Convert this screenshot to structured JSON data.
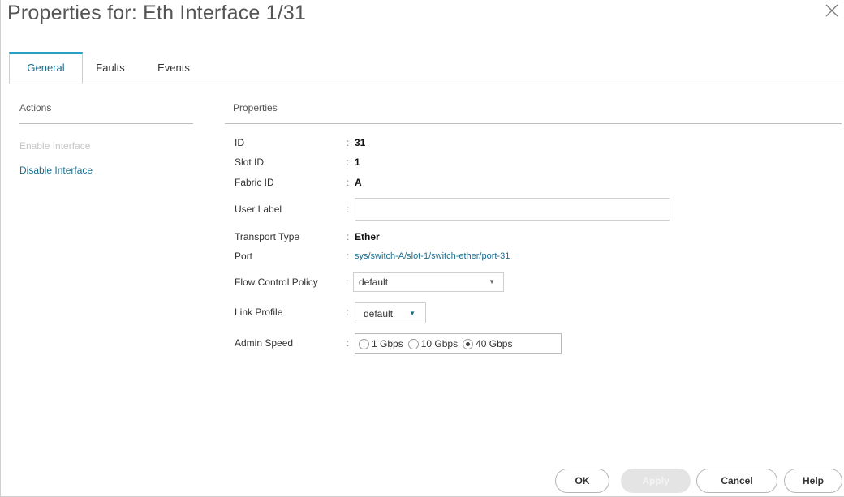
{
  "dialog": {
    "title": "Properties for: Eth Interface 1/31",
    "close_icon": "close-icon"
  },
  "tabs": [
    {
      "label": "General",
      "active": true
    },
    {
      "label": "Faults",
      "active": false
    },
    {
      "label": "Events",
      "active": false
    }
  ],
  "actions": {
    "heading": "Actions",
    "items": [
      {
        "label": "Enable Interface",
        "enabled": false
      },
      {
        "label": "Disable Interface",
        "enabled": true
      }
    ]
  },
  "properties": {
    "heading": "Properties",
    "id": {
      "label": "ID",
      "value": "31"
    },
    "slot_id": {
      "label": "Slot ID",
      "value": "1"
    },
    "fabric_id": {
      "label": "Fabric ID",
      "value": "A"
    },
    "user_label": {
      "label": "User Label",
      "value": "",
      "placeholder": ""
    },
    "transport_type": {
      "label": "Transport Type",
      "value": "Ether"
    },
    "port": {
      "label": "Port",
      "value": "sys/switch-A/slot-1/switch-ether/port-31"
    },
    "flow_control_policy": {
      "label": "Flow Control Policy",
      "value": "default"
    },
    "link_profile": {
      "label": "Link Profile",
      "value": "default"
    },
    "admin_speed": {
      "label": "Admin Speed",
      "options": [
        {
          "label": "1 Gbps",
          "selected": false
        },
        {
          "label": "10 Gbps",
          "selected": false
        },
        {
          "label": "40 Gbps",
          "selected": true
        }
      ]
    }
  },
  "buttons": {
    "ok": {
      "label": "OK",
      "enabled": true
    },
    "apply": {
      "label": "Apply",
      "enabled": false
    },
    "cancel": {
      "label": "Cancel",
      "enabled": true
    },
    "help": {
      "label": "Help",
      "enabled": true
    }
  },
  "colors": {
    "accent": "#2a9fc5",
    "link": "#1c6d8f",
    "disabled_text": "#c6c6c6"
  }
}
